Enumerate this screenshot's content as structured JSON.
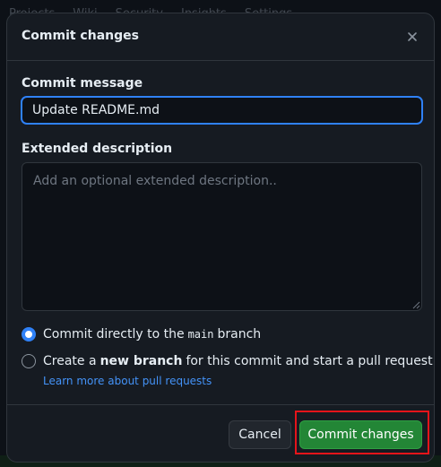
{
  "background_nav": [
    "Projects",
    "Wiki",
    "Security",
    "Insights",
    "Settings"
  ],
  "dialog": {
    "title": "Commit changes",
    "close_icon": "close-icon"
  },
  "commit_message": {
    "label": "Commit message",
    "value": "Update README.md"
  },
  "extended_description": {
    "label": "Extended description",
    "placeholder": "Add an optional extended description..",
    "value": ""
  },
  "options": {
    "direct": {
      "prefix": "Commit directly to the",
      "branch": "main",
      "suffix": "branch",
      "checked": true
    },
    "new_branch": {
      "prefix": "Create a",
      "bold": "new branch",
      "suffix": "for this commit and start a pull request",
      "checked": false
    },
    "learn_more": "Learn more about pull requests"
  },
  "buttons": {
    "cancel": "Cancel",
    "commit": "Commit changes"
  },
  "colors": {
    "accent": "#2f81f7",
    "commit_button": "#238636",
    "highlight": "#e5141a"
  }
}
